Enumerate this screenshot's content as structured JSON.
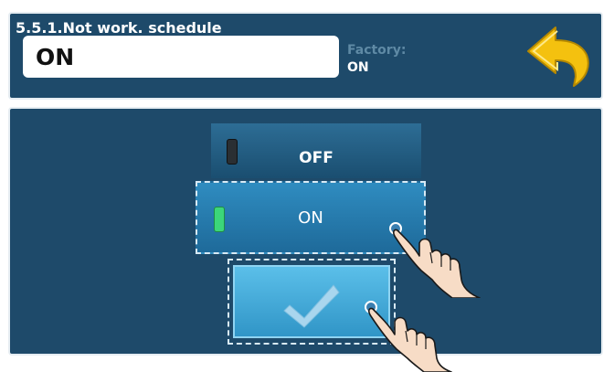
{
  "header": {
    "title": "5.5.1.Not work. schedule",
    "current_value": "ON",
    "factory_label": "Factory:",
    "factory_value": "ON"
  },
  "options": [
    {
      "label": "OFF",
      "selected": false
    },
    {
      "label": "ON",
      "selected": true
    }
  ],
  "icons": {
    "back": "back-arrow-icon",
    "confirm": "checkmark-icon",
    "pointer": "pointing-hand-icon"
  },
  "colors": {
    "panel": "#1e4a6a",
    "accent_green": "#3cd67a",
    "back_arrow": "#f4c10f"
  }
}
